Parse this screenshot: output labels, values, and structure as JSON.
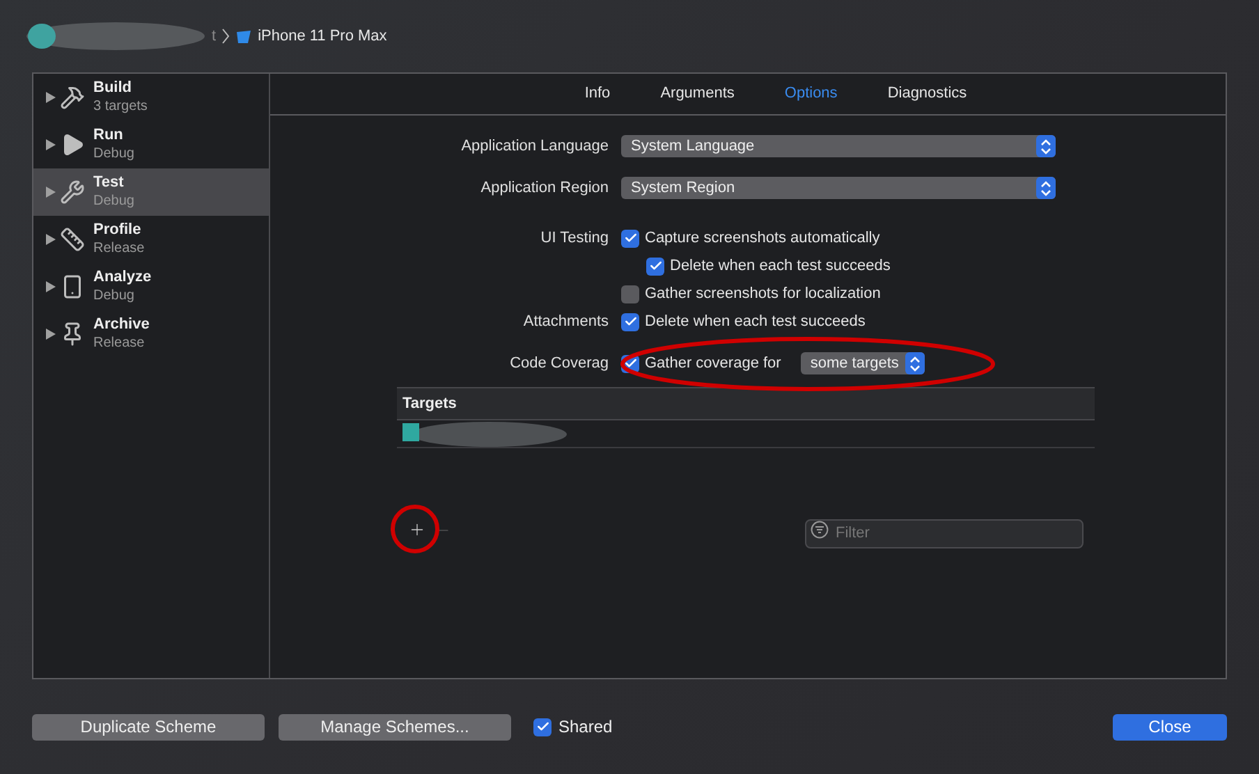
{
  "breadcrumb": {
    "partial": "t",
    "device": "iPhone 11 Pro Max"
  },
  "sidebar": {
    "items": [
      {
        "kind": "build",
        "name": "Build",
        "detail": "3 targets",
        "selected": false
      },
      {
        "kind": "run",
        "name": "Run",
        "detail": "Debug",
        "selected": false
      },
      {
        "kind": "test",
        "name": "Test",
        "detail": "Debug",
        "selected": true
      },
      {
        "kind": "profile",
        "name": "Profile",
        "detail": "Release",
        "selected": false
      },
      {
        "kind": "analyze",
        "name": "Analyze",
        "detail": "Debug",
        "selected": false
      },
      {
        "kind": "archive",
        "name": "Archive",
        "detail": "Release",
        "selected": false
      }
    ]
  },
  "tabs": [
    {
      "label": "Info",
      "selected": false
    },
    {
      "label": "Arguments",
      "selected": false
    },
    {
      "label": "Options",
      "selected": true
    },
    {
      "label": "Diagnostics",
      "selected": false
    }
  ],
  "sections": [
    [
      {
        "kind": "popup",
        "label": "Application Language",
        "value": "System Language"
      },
      {
        "kind": "popup",
        "label": "Application Region",
        "value": "System Region"
      }
    ],
    [
      {
        "kind": "checkbox",
        "label": "UI Testing",
        "text": "Capture screenshots automatically",
        "checked": true,
        "children": [
          {
            "text": "Delete when each test succeeds",
            "checked": true
          }
        ]
      },
      {
        "kind": "checkbox",
        "text": "Gather screenshots for localization",
        "checked": false
      },
      {
        "kind": "checkbox",
        "label": "Attachments",
        "text": "Delete when each test succeeds",
        "checked": true
      }
    ],
    [
      {
        "kind": "coverage",
        "label": "Code Coverag",
        "text": "Gather coverage for",
        "checked": true,
        "value": "some targets"
      }
    ]
  ],
  "targets_table": {
    "columns": [
      "Targets"
    ]
  },
  "filter": {
    "placeholder": "Filter"
  },
  "footer": {
    "buttons": [
      "Duplicate Scheme",
      "Manage Schemes..."
    ],
    "shared": {
      "label": "Shared",
      "checked": true
    },
    "close": "Close"
  }
}
